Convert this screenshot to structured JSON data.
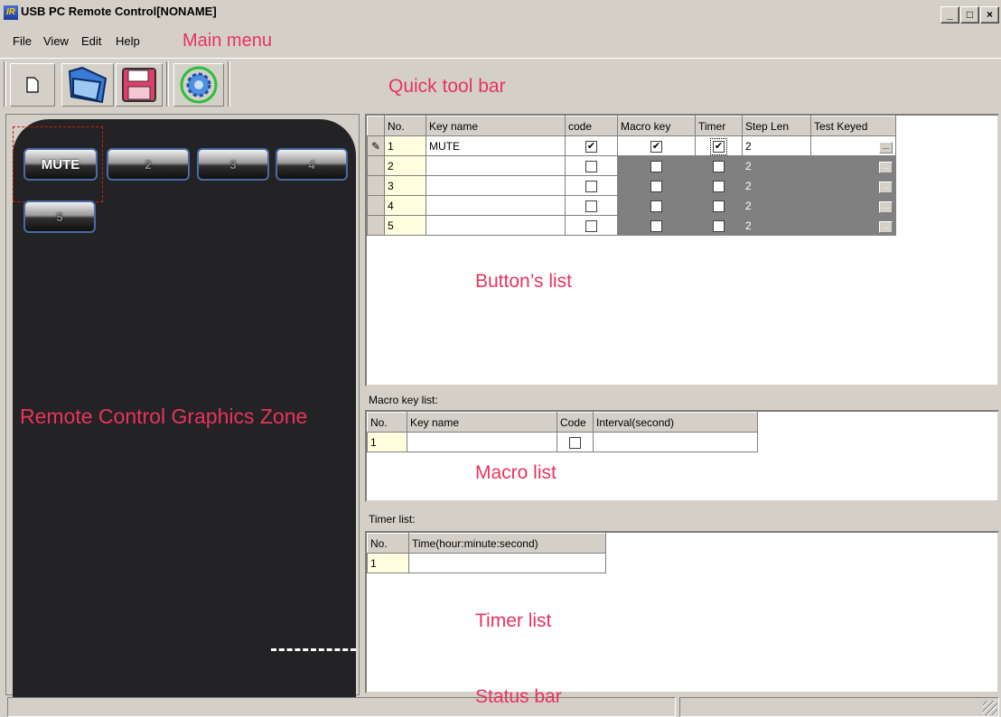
{
  "window": {
    "icon_text": "IR",
    "title": "USB PC Remote Control[NONAME]",
    "controls": [
      "_",
      "□",
      "×"
    ]
  },
  "menu": {
    "items": [
      "File",
      "View",
      "Edit",
      "Help"
    ],
    "annotation": "Main menu"
  },
  "toolbar": {
    "annotation": "Quick tool bar",
    "buttons": [
      "new-icon",
      "open-folder-icon",
      "save-icon",
      "settings-gear-icon"
    ]
  },
  "remote": {
    "annotation": "Remote Control Graphics Zone",
    "buttons": [
      "MUTE",
      "2",
      "3",
      "4",
      "5"
    ]
  },
  "buttons_list": {
    "annotation": "Button’s list",
    "columns": [
      "No.",
      "Key name",
      "code",
      "Macro key",
      "Timer",
      "Step Len",
      "Test Keyed"
    ],
    "rows": [
      {
        "no": "1",
        "key_name": "MUTE",
        "code": true,
        "macro": true,
        "timer": true,
        "step": "2"
      },
      {
        "no": "2",
        "key_name": "",
        "code": false,
        "macro": false,
        "timer": false,
        "step": "2"
      },
      {
        "no": "3",
        "key_name": "",
        "code": false,
        "macro": false,
        "timer": false,
        "step": "2"
      },
      {
        "no": "4",
        "key_name": "",
        "code": false,
        "macro": false,
        "timer": false,
        "step": "2"
      },
      {
        "no": "5",
        "key_name": "",
        "code": false,
        "macro": false,
        "timer": false,
        "step": "2"
      }
    ],
    "dots": "..."
  },
  "macro": {
    "label": "Macro key list:",
    "annotation": "Macro list",
    "columns": [
      "No.",
      "Key name",
      "Code",
      "Interval(second)"
    ],
    "row_no": "1"
  },
  "timer": {
    "label": "Timer list:",
    "annotation": "Timer list",
    "columns": [
      "No.",
      "Time(hour:minute:second)"
    ],
    "row_no": "1"
  },
  "status": {
    "annotation": "Status bar"
  },
  "colors": {
    "annotation": "#e8335e",
    "window_bg": "#d4d0c8",
    "remote_bg": "#232325"
  }
}
